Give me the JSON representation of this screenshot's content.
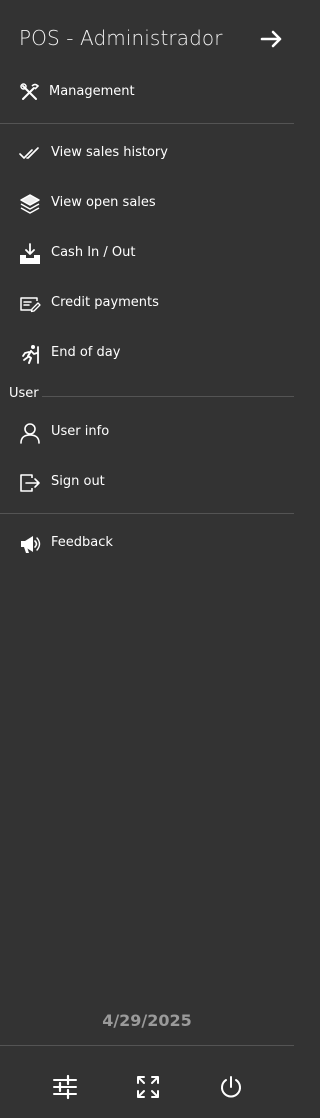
{
  "header": {
    "title": "POS - Administrador",
    "collapse_icon": "arrow-right-icon"
  },
  "menu": {
    "management": {
      "label": "Management",
      "icon": "tools-icon"
    },
    "sales_history": {
      "label": "View sales history",
      "icon": "double-check-icon"
    },
    "open_sales": {
      "label": "View open sales",
      "icon": "layers-icon"
    },
    "cash_in_out": {
      "label": "Cash In / Out",
      "icon": "tray-download-icon"
    },
    "credit_payments": {
      "label": "Credit payments",
      "icon": "edit-card-icon"
    },
    "end_of_day": {
      "label": "End of day",
      "icon": "running-person-icon"
    }
  },
  "user_section": {
    "title": "User",
    "user_info": {
      "label": "User info",
      "icon": "person-icon"
    },
    "sign_out": {
      "label": "Sign out",
      "icon": "sign-out-icon"
    }
  },
  "feedback": {
    "label": "Feedback",
    "icon": "megaphone-icon"
  },
  "date": "4/29/2025",
  "footer": {
    "buttons": [
      "sliders-icon",
      "fullscreen-icon",
      "power-icon"
    ]
  },
  "colors": {
    "background": "#333333",
    "text": "#ffffff",
    "divider": "#545454",
    "date": "#9a9a9a"
  }
}
